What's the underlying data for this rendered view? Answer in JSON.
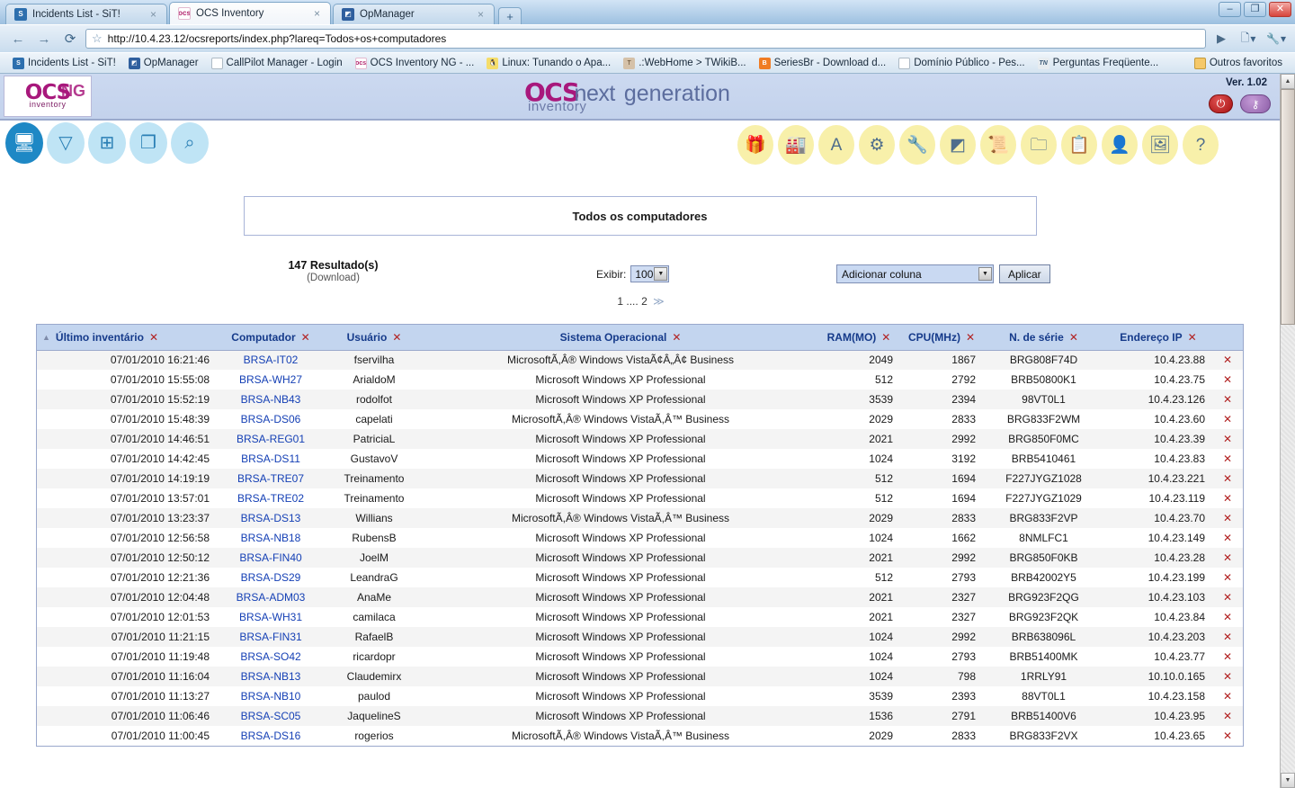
{
  "browser": {
    "tabs": [
      {
        "title": "Incidents List - SiT!",
        "icon": "sit-icon",
        "active": false,
        "close": "×"
      },
      {
        "title": "OCS Inventory",
        "icon": "ocs-icon",
        "active": true,
        "close": "×"
      },
      {
        "title": "OpManager",
        "icon": "opmanager-icon",
        "active": false,
        "close": "×"
      }
    ],
    "new_tab_label": "+",
    "window_controls": {
      "minimize": "–",
      "maximize": "❐",
      "close": "✕"
    },
    "nav": {
      "back": "←",
      "forward": "→",
      "reload": "⟳",
      "star": "☆",
      "go": "▶",
      "page_menu": "☷",
      "wrench": "🔧"
    },
    "url": "http://10.4.23.12/ocsreports/index.php?lareq=Todos+os+computadores",
    "bookmarks": [
      {
        "label": "Incidents List - SiT!",
        "icon": "sit-icon"
      },
      {
        "label": "OpManager",
        "icon": "opmanager-icon"
      },
      {
        "label": "CallPilot Manager - Login",
        "icon": "document-icon"
      },
      {
        "label": "OCS Inventory NG - ...",
        "icon": "ocs-icon"
      },
      {
        "label": "Linux: Tunando o Apa...",
        "icon": "linux-icon"
      },
      {
        "label": ".:WebHome > TWikiB...",
        "icon": "twiki-icon"
      },
      {
        "label": "SeriesBr - Download d...",
        "icon": "blogger-icon"
      },
      {
        "label": "Domínio Público - Pes...",
        "icon": "document-icon"
      },
      {
        "label": "Perguntas Freqüente...",
        "icon": "tn-icon"
      }
    ],
    "other_bookmarks": {
      "label": "Outros favoritos",
      "icon": "folder-icon"
    }
  },
  "app": {
    "logo_main": "OCS",
    "logo_sub": "inventory",
    "logo_ng": "NG",
    "center_logo": {
      "ocs": "OCS",
      "next": "next",
      "generation": "generation",
      "inventory": "inventory"
    },
    "version": "Ver. 1.02",
    "header_buttons": [
      {
        "name": "logout-button",
        "glyph": "⏻"
      },
      {
        "name": "key-button",
        "glyph": "⚷"
      }
    ],
    "toolbar_left": [
      {
        "name": "computers-icon",
        "glyph": "὚5",
        "active": true
      },
      {
        "name": "filter-icon",
        "glyph": "▽",
        "active": false
      },
      {
        "name": "tree-icon",
        "glyph": "⊞",
        "active": false
      },
      {
        "name": "groups-icon",
        "glyph": "❐",
        "active": false
      },
      {
        "name": "search-icon",
        "glyph": "⚲",
        "active": false
      }
    ],
    "toolbar_right": [
      {
        "name": "package-icon",
        "glyph": "Ἰ1"
      },
      {
        "name": "network-icon",
        "glyph": "Ἶd"
      },
      {
        "name": "az-icon",
        "glyph": "A"
      },
      {
        "name": "gears-icon",
        "glyph": "⚙"
      },
      {
        "name": "wrench-icon",
        "glyph": "ὒ7"
      },
      {
        "name": "blocks-icon",
        "glyph": "◰"
      },
      {
        "name": "scroll-icon",
        "glyph": "Ὅc"
      },
      {
        "name": "archive-icon",
        "glyph": "Ὄ1"
      },
      {
        "name": "label-icon",
        "glyph": "Ὄb"
      },
      {
        "name": "user-icon",
        "glyph": "὆4"
      },
      {
        "name": "picture-icon",
        "glyph": "Ὓc"
      },
      {
        "name": "help-icon",
        "glyph": "?"
      }
    ]
  },
  "main": {
    "title": "Todos os computadores",
    "results_count": "147 Resultado(s)",
    "download_label": "(Download)",
    "exibir_label": "Exibir:",
    "exibir_value": "100",
    "add_column_value": "Adicionar coluna",
    "apply_label": "Aplicar",
    "pager": {
      "page1": "1",
      "ellipsis": "....",
      "page2": "2",
      "next": "≫"
    },
    "columns": [
      {
        "key": "date",
        "label": "Último inventário",
        "sorted": true
      },
      {
        "key": "comp",
        "label": "Computador",
        "sorted": false
      },
      {
        "key": "user",
        "label": "Usuário",
        "sorted": false
      },
      {
        "key": "os",
        "label": "Sistema Operacional",
        "sorted": false
      },
      {
        "key": "ram",
        "label": "RAM(MO)",
        "sorted": false
      },
      {
        "key": "cpu",
        "label": "CPU(MHz)",
        "sorted": false
      },
      {
        "key": "sn",
        "label": "N. de série",
        "sorted": false
      },
      {
        "key": "ip",
        "label": "Endereço IP",
        "sorted": false
      }
    ],
    "remove_glyph": "✕",
    "rows": [
      {
        "date": "07/01/2010 16:21:46",
        "comp": "BRSA-IT02",
        "user": "fservilha",
        "os": "MicrosoftÃ,Â® Windows VistaÃ¢Â„Â¢ Business",
        "ram": "2049",
        "cpu": "1867",
        "sn": "BRG808F74D",
        "ip": "10.4.23.88"
      },
      {
        "date": "07/01/2010 15:55:08",
        "comp": "BRSA-WH27",
        "user": "ArialdoM",
        "os": "Microsoft Windows XP Professional",
        "ram": "512",
        "cpu": "2792",
        "sn": "BRB50800K1",
        "ip": "10.4.23.75"
      },
      {
        "date": "07/01/2010 15:52:19",
        "comp": "BRSA-NB43",
        "user": "rodolfot",
        "os": "Microsoft Windows XP Professional",
        "ram": "3539",
        "cpu": "2394",
        "sn": "98VT0L1",
        "ip": "10.4.23.126"
      },
      {
        "date": "07/01/2010 15:48:39",
        "comp": "BRSA-DS06",
        "user": "capelati",
        "os": "MicrosoftÃ,Â® Windows VistaÃ,Â™ Business",
        "ram": "2029",
        "cpu": "2833",
        "sn": "BRG833F2WM",
        "ip": "10.4.23.60"
      },
      {
        "date": "07/01/2010 14:46:51",
        "comp": "BRSA-REG01",
        "user": "PatriciaL",
        "os": "Microsoft Windows XP Professional",
        "ram": "2021",
        "cpu": "2992",
        "sn": "BRG850F0MC",
        "ip": "10.4.23.39"
      },
      {
        "date": "07/01/2010 14:42:45",
        "comp": "BRSA-DS11",
        "user": "GustavoV",
        "os": "Microsoft Windows XP Professional",
        "ram": "1024",
        "cpu": "3192",
        "sn": "BRB5410461",
        "ip": "10.4.23.83"
      },
      {
        "date": "07/01/2010 14:19:19",
        "comp": "BRSA-TRE07",
        "user": "Treinamento",
        "os": "Microsoft Windows XP Professional",
        "ram": "512",
        "cpu": "1694",
        "sn": "F227JYGZ1028",
        "ip": "10.4.23.221"
      },
      {
        "date": "07/01/2010 13:57:01",
        "comp": "BRSA-TRE02",
        "user": "Treinamento",
        "os": "Microsoft Windows XP Professional",
        "ram": "512",
        "cpu": "1694",
        "sn": "F227JYGZ1029",
        "ip": "10.4.23.119"
      },
      {
        "date": "07/01/2010 13:23:37",
        "comp": "BRSA-DS13",
        "user": "Willians",
        "os": "MicrosoftÃ,Â® Windows VistaÃ,Â™ Business",
        "ram": "2029",
        "cpu": "2833",
        "sn": "BRG833F2VP",
        "ip": "10.4.23.70"
      },
      {
        "date": "07/01/2010 12:56:58",
        "comp": "BRSA-NB18",
        "user": "RubensB",
        "os": "Microsoft Windows XP Professional",
        "ram": "1024",
        "cpu": "1662",
        "sn": "8NMLFC1",
        "ip": "10.4.23.149"
      },
      {
        "date": "07/01/2010 12:50:12",
        "comp": "BRSA-FIN40",
        "user": "JoelM",
        "os": "Microsoft Windows XP Professional",
        "ram": "2021",
        "cpu": "2992",
        "sn": "BRG850F0KB",
        "ip": "10.4.23.28"
      },
      {
        "date": "07/01/2010 12:21:36",
        "comp": "BRSA-DS29",
        "user": "LeandraG",
        "os": "Microsoft Windows XP Professional",
        "ram": "512",
        "cpu": "2793",
        "sn": "BRB42002Y5",
        "ip": "10.4.23.199"
      },
      {
        "date": "07/01/2010 12:04:48",
        "comp": "BRSA-ADM03",
        "user": "AnaMe",
        "os": "Microsoft Windows XP Professional",
        "ram": "2021",
        "cpu": "2327",
        "sn": "BRG923F2QG",
        "ip": "10.4.23.103"
      },
      {
        "date": "07/01/2010 12:01:53",
        "comp": "BRSA-WH31",
        "user": "camilaca",
        "os": "Microsoft Windows XP Professional",
        "ram": "2021",
        "cpu": "2327",
        "sn": "BRG923F2QK",
        "ip": "10.4.23.84"
      },
      {
        "date": "07/01/2010 11:21:15",
        "comp": "BRSA-FIN31",
        "user": "RafaelB",
        "os": "Microsoft Windows XP Professional",
        "ram": "1024",
        "cpu": "2992",
        "sn": "BRB638096L",
        "ip": "10.4.23.203"
      },
      {
        "date": "07/01/2010 11:19:48",
        "comp": "BRSA-SO42",
        "user": "ricardopr",
        "os": "Microsoft Windows XP Professional",
        "ram": "1024",
        "cpu": "2793",
        "sn": "BRB51400MK",
        "ip": "10.4.23.77"
      },
      {
        "date": "07/01/2010 11:16:04",
        "comp": "BRSA-NB13",
        "user": "Claudemirx",
        "os": "Microsoft Windows XP Professional",
        "ram": "1024",
        "cpu": "798",
        "sn": "1RRLY91",
        "ip": "10.10.0.165"
      },
      {
        "date": "07/01/2010 11:13:27",
        "comp": "BRSA-NB10",
        "user": "paulod",
        "os": "Microsoft Windows XP Professional",
        "ram": "3539",
        "cpu": "2393",
        "sn": "88VT0L1",
        "ip": "10.4.23.158"
      },
      {
        "date": "07/01/2010 11:06:46",
        "comp": "BRSA-SC05",
        "user": "JaquelineS",
        "os": "Microsoft Windows XP Professional",
        "ram": "1536",
        "cpu": "2791",
        "sn": "BRB51400V6",
        "ip": "10.4.23.95"
      },
      {
        "date": "07/01/2010 11:00:45",
        "comp": "BRSA-DS16",
        "user": "rogerios",
        "os": "MicrosoftÃ,Â® Windows VistaÃ,Â™ Business",
        "ram": "2029",
        "cpu": "2833",
        "sn": "BRG833F2VX",
        "ip": "10.4.23.65"
      }
    ]
  },
  "scrollbar": {
    "up": "▲",
    "down": "▼"
  }
}
